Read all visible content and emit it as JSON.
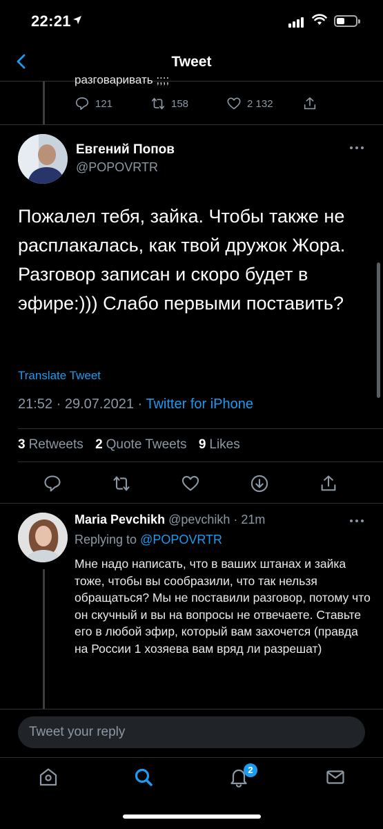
{
  "status_bar": {
    "time": "22:21"
  },
  "header": {
    "title": "Tweet"
  },
  "previous_tweet": {
    "text_fragment": "разговаривать ;;;;",
    "replies": "121",
    "retweets": "158",
    "likes": "2 132"
  },
  "main_tweet": {
    "author_name": "Евгений Попов",
    "author_handle": "@POPOVRTR",
    "text": "Пожалел тебя, зайка. Чтобы также не расплакалась, как твой дружок Жора. Разговор записан и скоро будет в эфире:))) Слабо первыми поставить?",
    "translate_label": "Translate Tweet",
    "time": "21:52",
    "date": "29.07.2021",
    "source": "Twitter for iPhone",
    "retweets_count": "3",
    "retweets_label": "Retweets",
    "quote_count": "2",
    "quote_label": "Quote Tweets",
    "likes_count": "9",
    "likes_label": "Likes"
  },
  "reply": {
    "author_name": "Maria Pevchikh",
    "author_handle": "@pevchikh",
    "time_ago": "21m",
    "replying_prefix": "Replying to",
    "replying_to": "@POPOVRTR",
    "text": "Мне надо написать, что в ваших штанах и зайка тоже, чтобы вы сообразили, что так нельзя обращаться? Мы не поставили разговор, потому что он скучный и вы на вопросы не отвечаете.  Ставьте его в любой эфир, который вам захочется (правда на России 1 хозяева вам вряд ли разрешат)"
  },
  "reply_bar": {
    "placeholder": "Tweet your reply"
  },
  "tab_bar": {
    "notifications_badge": "2"
  },
  "colors": {
    "accent": "#1d9bf0",
    "background": "#000000",
    "secondary_text": "#8b98a5",
    "divider": "#2f3336"
  }
}
